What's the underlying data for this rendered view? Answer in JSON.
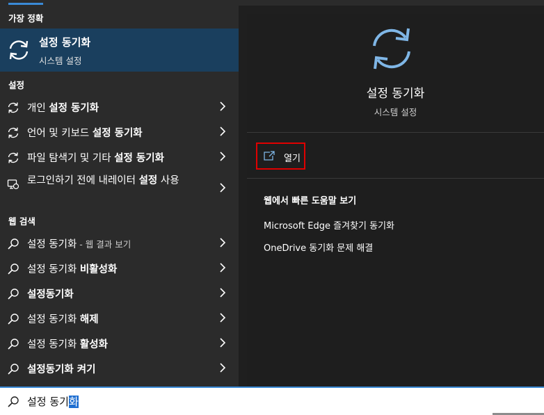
{
  "sections": {
    "best_match": "가장 정확",
    "settings": "설정",
    "web_search": "웹 검색"
  },
  "best_match": {
    "title": "설정 동기화",
    "subtitle": "시스템 설정"
  },
  "settings_items": [
    {
      "pre": "개인 ",
      "bold": "설정 동기화",
      "icon": "sync-icon"
    },
    {
      "pre": "언어 및 키보드 ",
      "bold": "설정 동기화",
      "icon": "sync-icon"
    },
    {
      "pre": "파일 탐색기 및 기타 ",
      "bold": "설정 동기화",
      "icon": "sync-icon"
    },
    {
      "pre": "로그인하기 전에 내레이터 ",
      "bold": "설정",
      "post": " 사용",
      "icon": "narrator-sync-icon"
    }
  ],
  "web_items": [
    {
      "pre": "설정 동기화",
      "muted": " - 웹 결과 보기",
      "bold": ""
    },
    {
      "pre": "설정 동기화 ",
      "bold": "비활성화"
    },
    {
      "pre": "설정동기화",
      "bold": ""
    },
    {
      "pre": "설정 동기화 ",
      "bold": "해제"
    },
    {
      "pre": "설정 동기화 ",
      "bold": "활성화"
    },
    {
      "pre": "설정동기화 ",
      "bold": "켜기"
    }
  ],
  "preview": {
    "title": "설정 동기화",
    "subtitle": "시스템 설정",
    "open_label": "열기",
    "web_heading": "웹에서 빠른 도움말 보기",
    "web_links": [
      "Microsoft Edge 즐겨찾기 동기화",
      "OneDrive 동기화 문제 해결"
    ]
  },
  "search": {
    "typed": "설정 동기",
    "selected": "화"
  },
  "colors": {
    "accent": "#3a8ad6",
    "best_bg": "#1a3f5e",
    "sync_icon": "#7fb6e6",
    "highlight_box": "#e00000"
  }
}
